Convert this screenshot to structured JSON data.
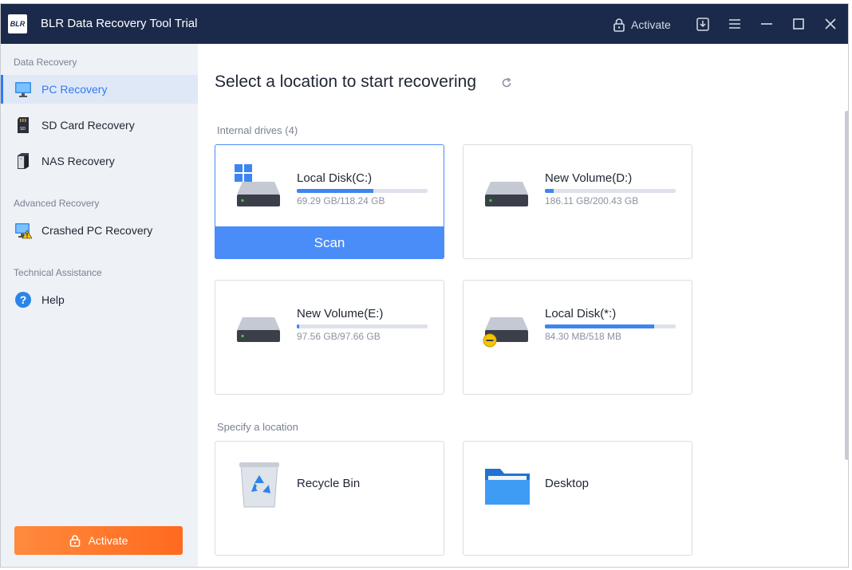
{
  "window": {
    "logo_text": "BLR",
    "title": "BLR Data Recovery Tool Trial",
    "activate_label": "Activate"
  },
  "sidebar": {
    "sections": [
      {
        "label": "Data Recovery"
      },
      {
        "label": "Advanced Recovery"
      },
      {
        "label": "Technical Assistance"
      }
    ],
    "items": [
      {
        "label": "PC Recovery",
        "icon": "monitor-icon",
        "active": true
      },
      {
        "label": "SD Card Recovery",
        "icon": "sd-card-icon"
      },
      {
        "label": "NAS Recovery",
        "icon": "nas-icon"
      },
      {
        "label": "Crashed PC Recovery",
        "icon": "crashed-pc-icon"
      },
      {
        "label": "Help",
        "icon": "help-icon"
      }
    ],
    "activate_label": "Activate"
  },
  "main": {
    "title": "Select a location to start recovering",
    "internal_label": "Internal drives (4)",
    "specify_label": "Specify a location",
    "drives": [
      {
        "name": "Local Disk(C:)",
        "size": "69.29 GB/118.24 GB",
        "usage": 0.586,
        "selected": true,
        "scan_label": "Scan"
      },
      {
        "name": "New Volume(D:)",
        "size": "186.11 GB/200.43 GB",
        "usage": 0.07
      },
      {
        "name": "New Volume(E:)",
        "size": "97.56 GB/97.66 GB",
        "usage": 0.02
      },
      {
        "name": "Local Disk(*:)",
        "size": "84.30 MB/518 MB",
        "usage": 0.837
      }
    ],
    "locations": [
      {
        "name": "Recycle Bin",
        "icon": "recycle-bin-icon"
      },
      {
        "name": "Desktop",
        "icon": "folder-icon"
      }
    ]
  },
  "colors": {
    "titlebar": "#1b2a4a",
    "accent": "#4a8df8",
    "activate_button": "#ff6a1f",
    "sidebar_bg": "#eef1f6"
  }
}
